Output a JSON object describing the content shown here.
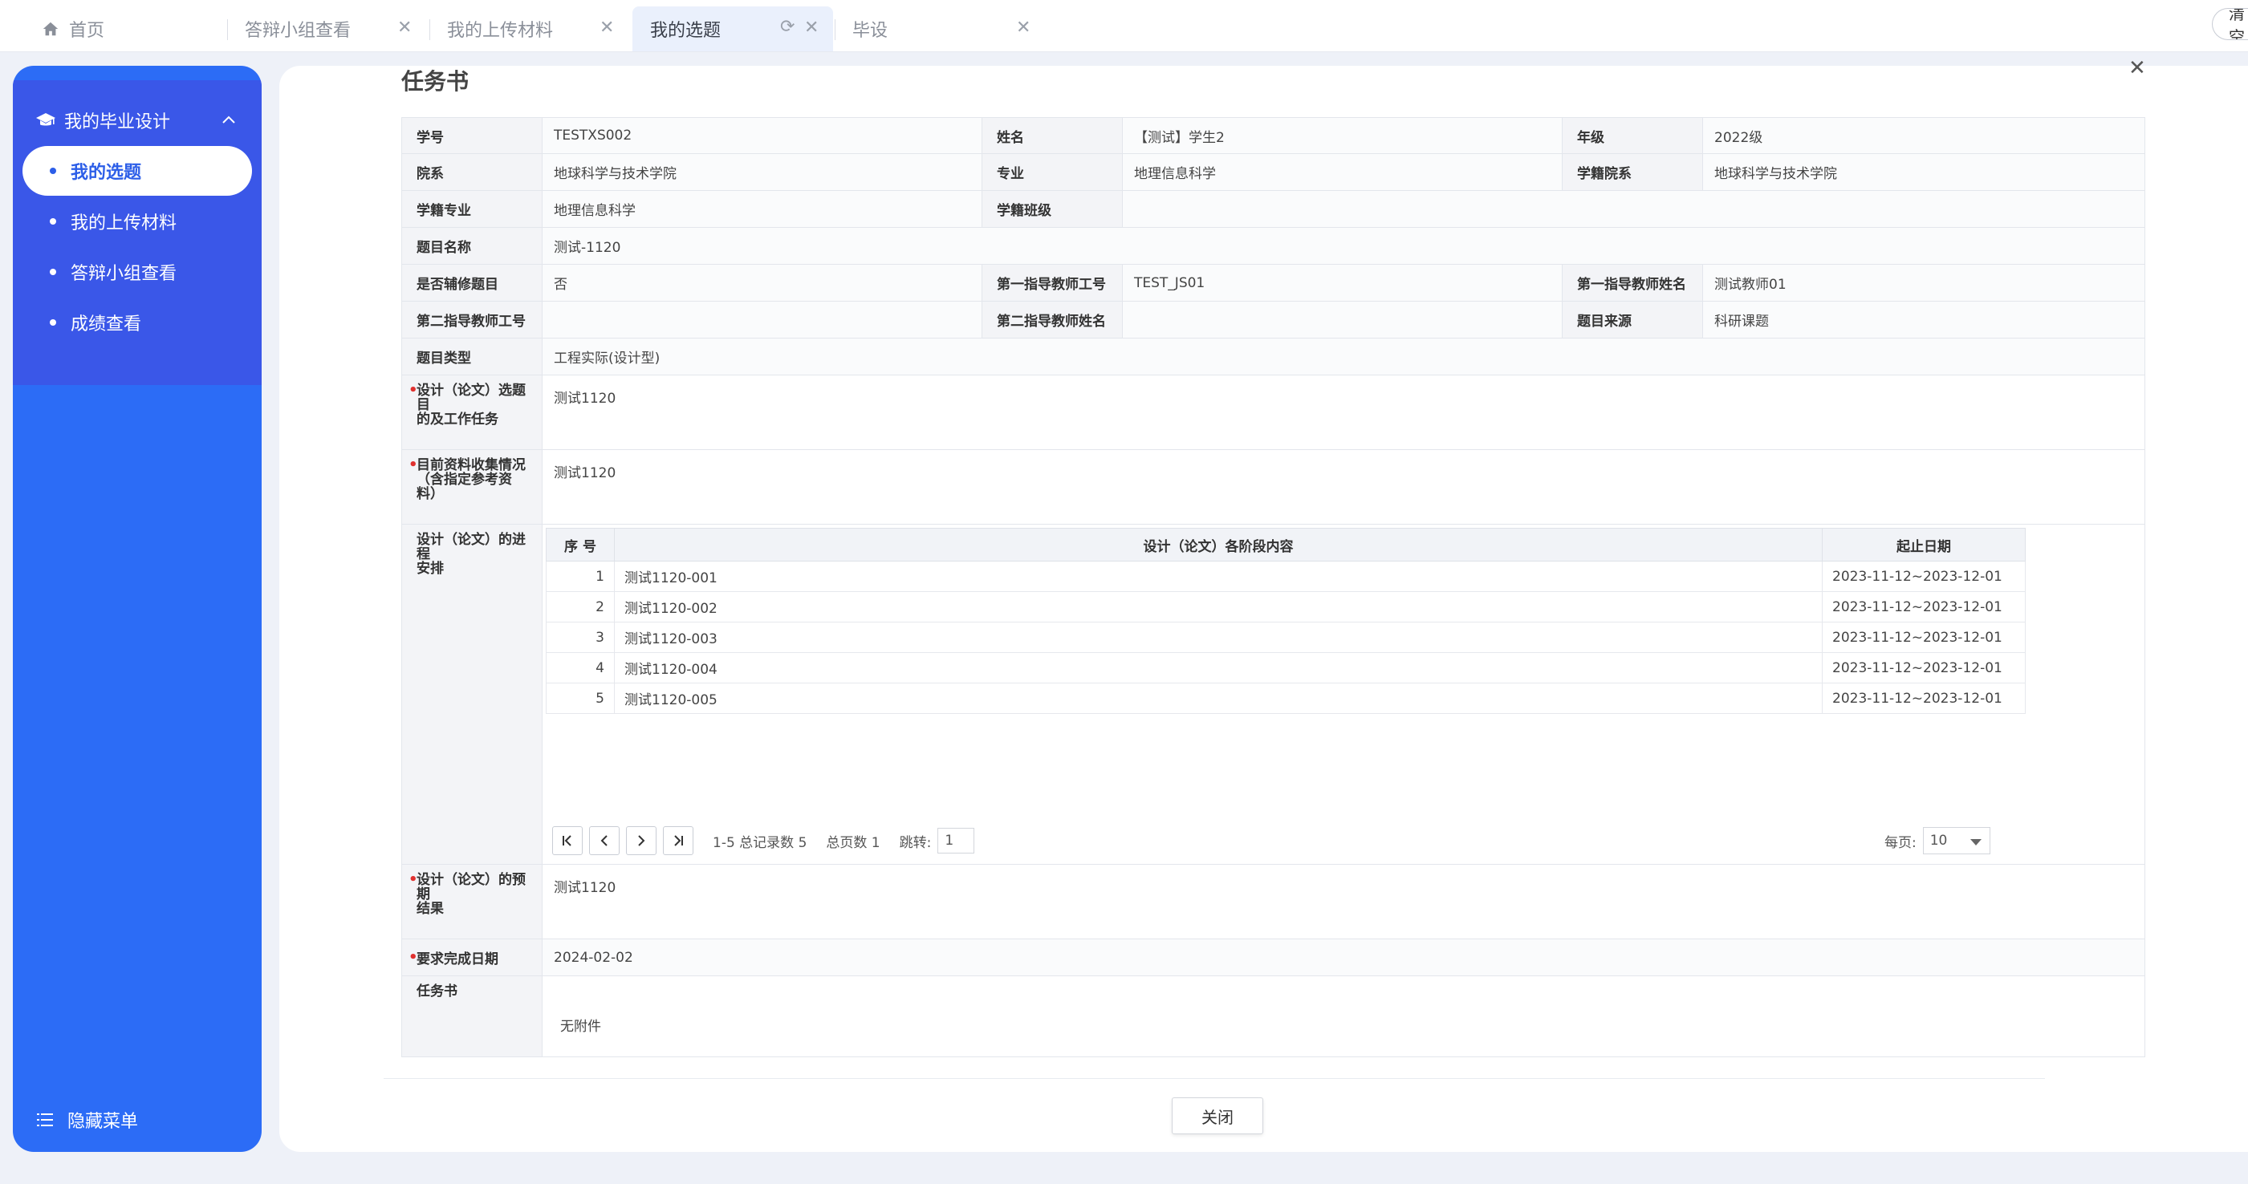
{
  "tabs": [
    {
      "label": "首页"
    },
    {
      "label": "答辩小组查看"
    },
    {
      "label": "我的上传材料"
    },
    {
      "label": "我的选题"
    },
    {
      "label": "毕设"
    }
  ],
  "clear_label": "清空",
  "sidebar": {
    "group_title": "我的毕业设计",
    "items": [
      {
        "label": "我的选题"
      },
      {
        "label": "我的上传材料"
      },
      {
        "label": "答辩小组查看"
      },
      {
        "label": "成绩查看"
      }
    ],
    "hide_menu": "隐藏菜单"
  },
  "page_title": "任务书",
  "form": {
    "student_id_label": "学号",
    "student_id": "TESTXS002",
    "name_label": "姓名",
    "name": "【测试】学生2",
    "grade_label": "年级",
    "grade": "2022级",
    "dept_label": "院系",
    "dept": "地球科学与技术学院",
    "major_label": "专业",
    "major": "地理信息科学",
    "reg_dept_label": "学籍院系",
    "reg_dept": "地球科学与技术学院",
    "reg_major_label": "学籍专业",
    "reg_major": "地理信息科学",
    "reg_class_label": "学籍班级",
    "reg_class": "",
    "topic_label": "题目名称",
    "topic": "测试-1120",
    "minor_label": "是否辅修题目",
    "minor": "否",
    "t1_id_label": "第一指导教师工号",
    "t1_id": "TEST_JS01",
    "t1_name_label": "第一指导教师姓名",
    "t1_name": "测试教师01",
    "t2_id_label": "第二指导教师工号",
    "t2_id": "",
    "t2_name_label": "第二指导教师姓名",
    "t2_name": "",
    "source_label": "题目来源",
    "source": "科研课题",
    "type_label": "题目类型",
    "type": "工程实际(设计型)",
    "purpose_label_1": "设计（论文）选题目",
    "purpose_label_2": "的及工作任务",
    "purpose": "测试1120",
    "material_label_1": "目前资料收集情况",
    "material_label_2": "（含指定参考资料）",
    "material": "测试1120",
    "schedule_label_1": "设计（论文）的进程",
    "schedule_label_2": "安排",
    "expected_label_1": "设计（论文）的预期",
    "expected_label_2": "结果",
    "expected": "测试1120",
    "deadline_label": "要求完成日期",
    "deadline": "2024-02-02",
    "taskbook_label": "任务书",
    "taskbook": "无附件"
  },
  "schedule": {
    "headers": {
      "no": "序 号",
      "content": "设计（论文）各阶段内容",
      "date": "起止日期"
    },
    "rows": [
      {
        "no": "1",
        "content": "测试1120-001",
        "date": "2023-11-12~2023-12-01"
      },
      {
        "no": "2",
        "content": "测试1120-002",
        "date": "2023-11-12~2023-12-01"
      },
      {
        "no": "3",
        "content": "测试1120-003",
        "date": "2023-11-12~2023-12-01"
      },
      {
        "no": "4",
        "content": "测试1120-004",
        "date": "2023-11-12~2023-12-01"
      },
      {
        "no": "5",
        "content": "测试1120-005",
        "date": "2023-11-12~2023-12-01"
      }
    ],
    "pager": {
      "range": "1-5 总记录数 5",
      "pages": "总页数 1",
      "jump_label": "跳转:",
      "jump_value": "1",
      "per_page_label": "每页:",
      "per_page_value": "10"
    }
  },
  "close_label": "关闭"
}
